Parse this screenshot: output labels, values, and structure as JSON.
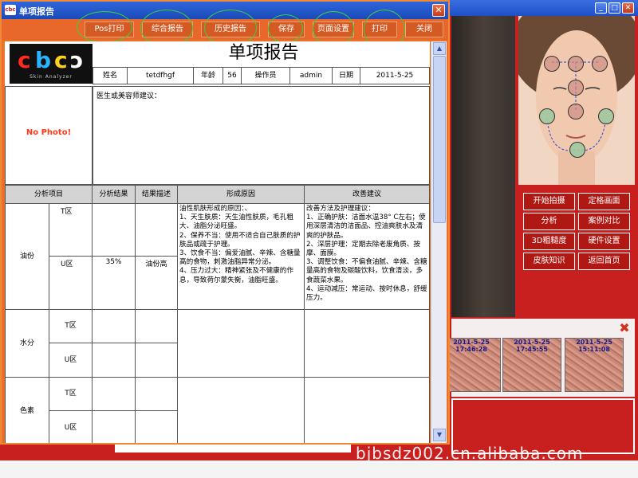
{
  "main_window": {
    "controls": {
      "minimize": "_",
      "maximize": "□",
      "close": "✕"
    },
    "side_buttons": [
      "开始拍摄",
      "定格画面",
      "分析",
      "案例对比",
      "3D粗糙度",
      "硬件设置",
      "皮肤知识",
      "返回首页"
    ],
    "thumbnails": [
      "2011-5-25 17:46:28",
      "2011-5-25 17:45:55",
      "2011-5-25 15:11:08"
    ],
    "watermark": "bjbsdz002.cn.alibaba.com"
  },
  "report": {
    "window_title": "单项报告",
    "app_icon_text": "cbc",
    "close_glyph": "✕",
    "toolbar": [
      "Pos打印",
      "综合报告",
      "历史报告",
      "保存",
      "页面设置",
      "打印",
      "关闭"
    ],
    "logo": {
      "letters": [
        "c",
        "b",
        "c",
        "ɔ"
      ],
      "subtitle": "Skin Analyzer"
    },
    "heading": "单项报告",
    "info": {
      "name_label": "姓名",
      "name": "tetdfhgf",
      "age_label": "年龄",
      "age": "56",
      "operator_label": "操作员",
      "operator": "admin",
      "date_label": "日期",
      "date": "2011-5-25"
    },
    "no_photo": "No Photo!",
    "advice_label": "医生或美容师建议：",
    "columns": [
      "分析项目",
      "分析结果",
      "结果描述",
      "形成原因",
      "改善建议"
    ],
    "rows": [
      {
        "item": "油份",
        "zones": [
          {
            "zone": "T区",
            "result": "",
            "desc": ""
          },
          {
            "zone": "U区",
            "result": "35%",
            "desc": "油份高"
          }
        ],
        "cause": "油性肌肤形成的原因：、\n1、天生肤质：天生油性肤质，毛孔粗大、油脂分泌旺盛。\n2、保养不当：使用不适合自己肤质的护肤品或疏于护理。\n3、饮食不当：偏爱油腻、辛辣、含糖量高的食物，刺激油脂异常分泌。\n4、压力过大：精神紧张及不健康的作息，导致荷尔蒙失衡，油脂旺盛。",
        "suggestion": "改善方法及护理建议：\n1、正确护肤：洁面水温38° C左右；使用深层清洁的洁面品、控油爽肤水及清爽的护肤品。\n2、深层护理：定期去除老废角质、按摩、面膜。\n3、调整饮食：不偏食油腻、辛辣、含糖量高的食物及碳酸饮料，饮食清淡，多食蔬菜水果。\n4、运动减压：常运动、按时休息，舒缓压力。"
      },
      {
        "item": "水分",
        "zones": [
          {
            "zone": "T区",
            "result": "",
            "desc": ""
          },
          {
            "zone": "U区",
            "result": "",
            "desc": ""
          }
        ],
        "cause": "",
        "suggestion": ""
      },
      {
        "item": "色素",
        "zones": [
          {
            "zone": "T区",
            "result": "",
            "desc": ""
          },
          {
            "zone": "U区",
            "result": "",
            "desc": ""
          }
        ],
        "cause": "",
        "suggestion": ""
      }
    ],
    "scroll": {
      "up": "▲",
      "down": "▼"
    }
  }
}
